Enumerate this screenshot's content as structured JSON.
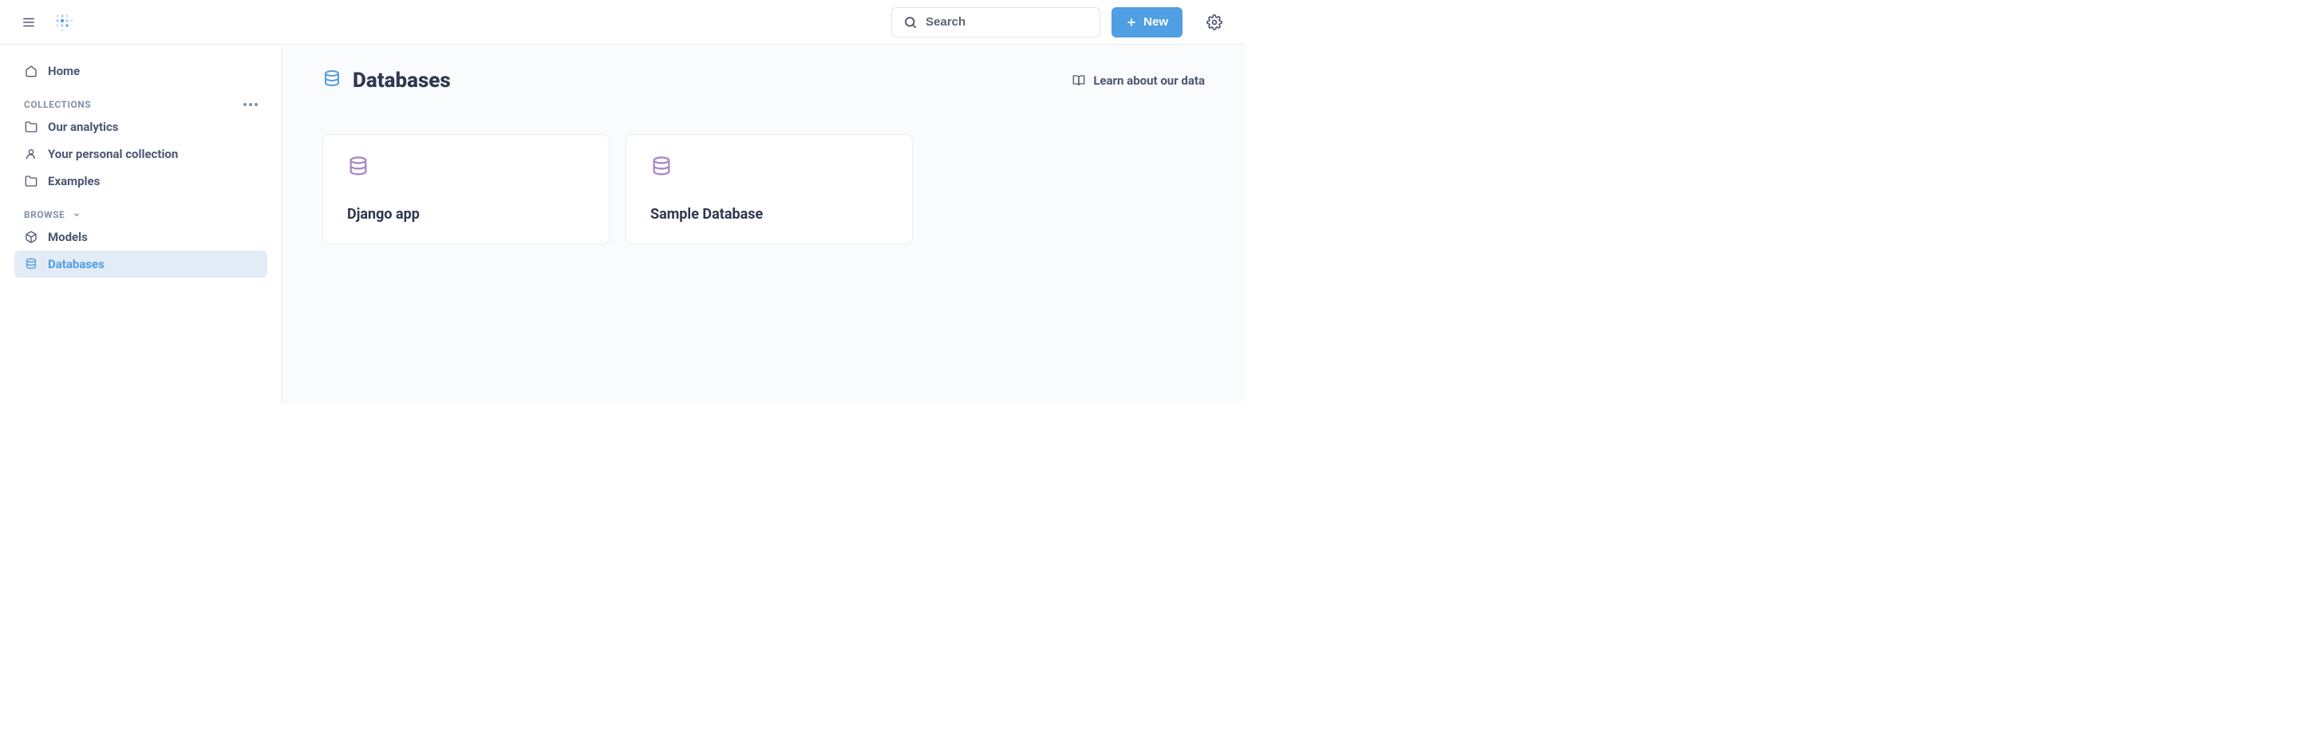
{
  "header": {
    "search_placeholder": "Search",
    "new_label": "New"
  },
  "sidebar": {
    "home_label": "Home",
    "collections_label": "COLLECTIONS",
    "collections": [
      {
        "label": "Our analytics",
        "icon": "folder"
      },
      {
        "label": "Your personal collection",
        "icon": "person"
      },
      {
        "label": "Examples",
        "icon": "folder"
      }
    ],
    "browse_label": "BROWSE",
    "browse_items": [
      {
        "label": "Models",
        "icon": "cube",
        "active": false
      },
      {
        "label": "Databases",
        "icon": "database",
        "active": true
      }
    ]
  },
  "main": {
    "title": "Databases",
    "learn_link": "Learn about our data",
    "databases": [
      {
        "name": "Django app"
      },
      {
        "name": "Sample Database"
      }
    ]
  }
}
